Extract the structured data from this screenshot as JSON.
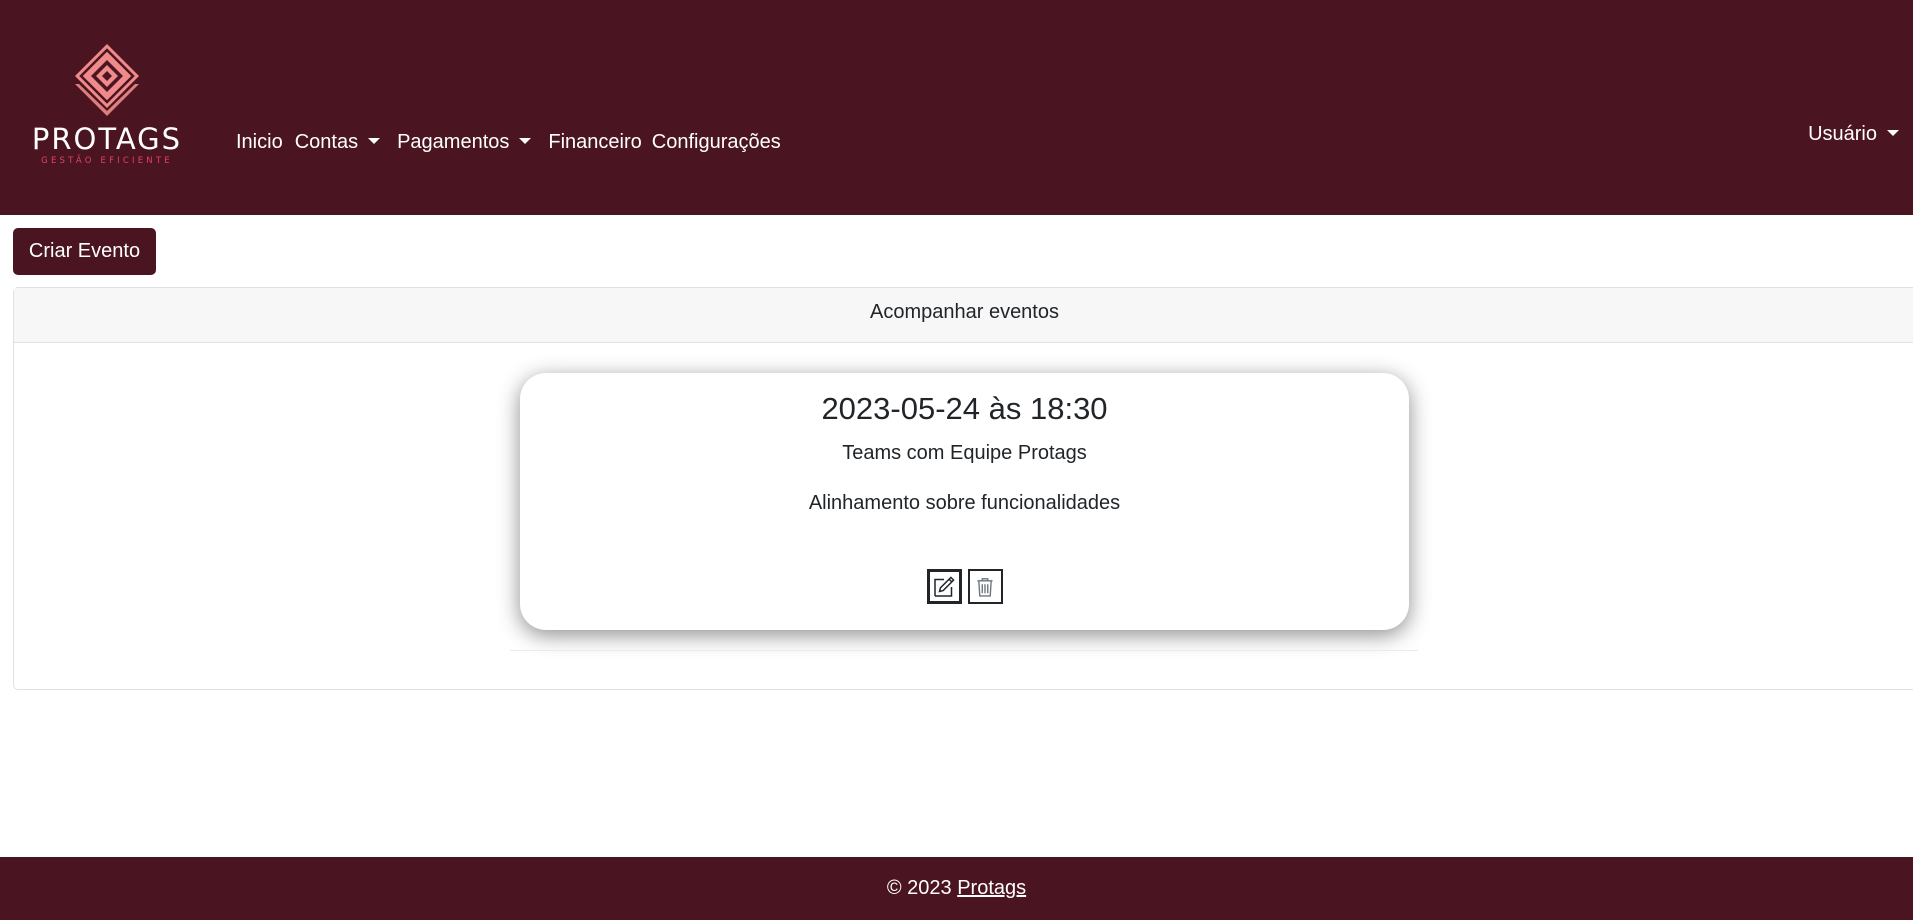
{
  "brand": {
    "name": "PROTAGS",
    "tagline": "GESTÃO EFICIENTE",
    "colors": {
      "primary": "#4a1520",
      "logo_pink": "#f08a8a",
      "tagline_pink": "#e0435e"
    }
  },
  "nav": {
    "items": [
      {
        "label": "Inicio",
        "dropdown": false
      },
      {
        "label": "Contas",
        "dropdown": true
      },
      {
        "label": "Pagamentos",
        "dropdown": true
      },
      {
        "label": "Financeiro",
        "dropdown": false
      },
      {
        "label": "Configurações",
        "dropdown": false
      }
    ],
    "user_label": "Usuário"
  },
  "actions": {
    "create_event_label": "Criar Evento"
  },
  "panel": {
    "title": "Acompanhar eventos"
  },
  "events": [
    {
      "datetime": "2023-05-24 às 18:30",
      "title": "Teams com Equipe Protags",
      "description": "Alinhamento sobre funcionalidades",
      "edit_icon": "pencil-square-icon",
      "delete_icon": "trash-icon"
    }
  ],
  "footer": {
    "copyright": "© 2023",
    "link_label": "Protags"
  }
}
